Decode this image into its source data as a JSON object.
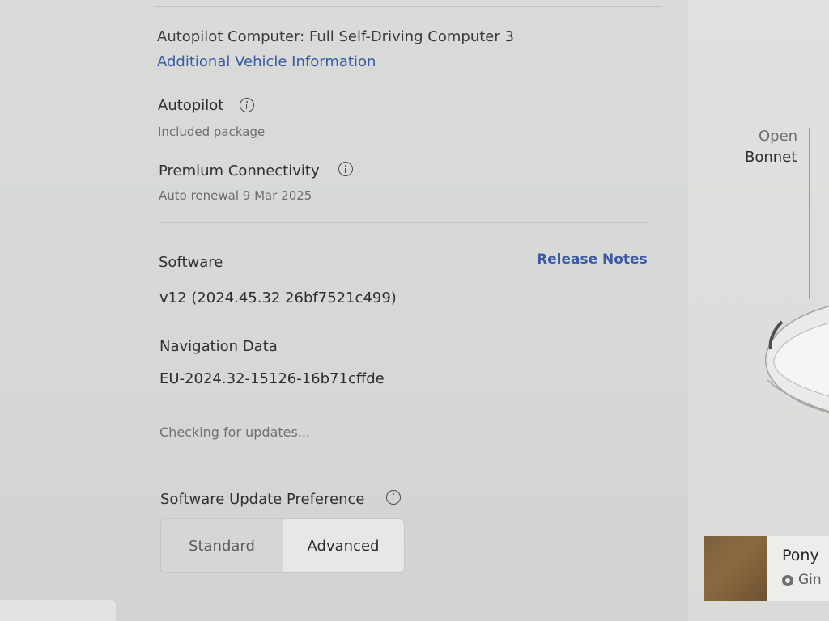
{
  "vehicle": {
    "autopilot_computer": "Autopilot Computer: Full Self-Driving Computer 3",
    "additional_info_link": "Additional Vehicle Information"
  },
  "autopilot": {
    "label": "Autopilot",
    "status": "Included package",
    "icon": "info-icon"
  },
  "premium_connectivity": {
    "label": "Premium Connectivity",
    "status": "Auto renewal 9 Mar 2025",
    "icon": "info-icon"
  },
  "software": {
    "label": "Software",
    "release_notes_link": "Release Notes",
    "version": "v12 (2024.45.32 26bf7521c499)"
  },
  "navigation_data": {
    "label": "Navigation Data",
    "version": "EU-2024.32-15126-16b71cffde"
  },
  "update_status": "Checking for updates...",
  "update_preference": {
    "label": "Software Update Preference",
    "icon": "info-icon",
    "options": [
      "Standard",
      "Advanced"
    ],
    "selected": "Advanced"
  },
  "right_panel": {
    "bonnet_open": "Open",
    "bonnet_label": "Bonnet",
    "media_title": "Pony",
    "media_source": "Gin",
    "media_source_icon": "disc-icon"
  },
  "colors": {
    "link": "#3a5aa6",
    "background": "#d6d9d6",
    "selected_segment": "#e6e8e6"
  }
}
